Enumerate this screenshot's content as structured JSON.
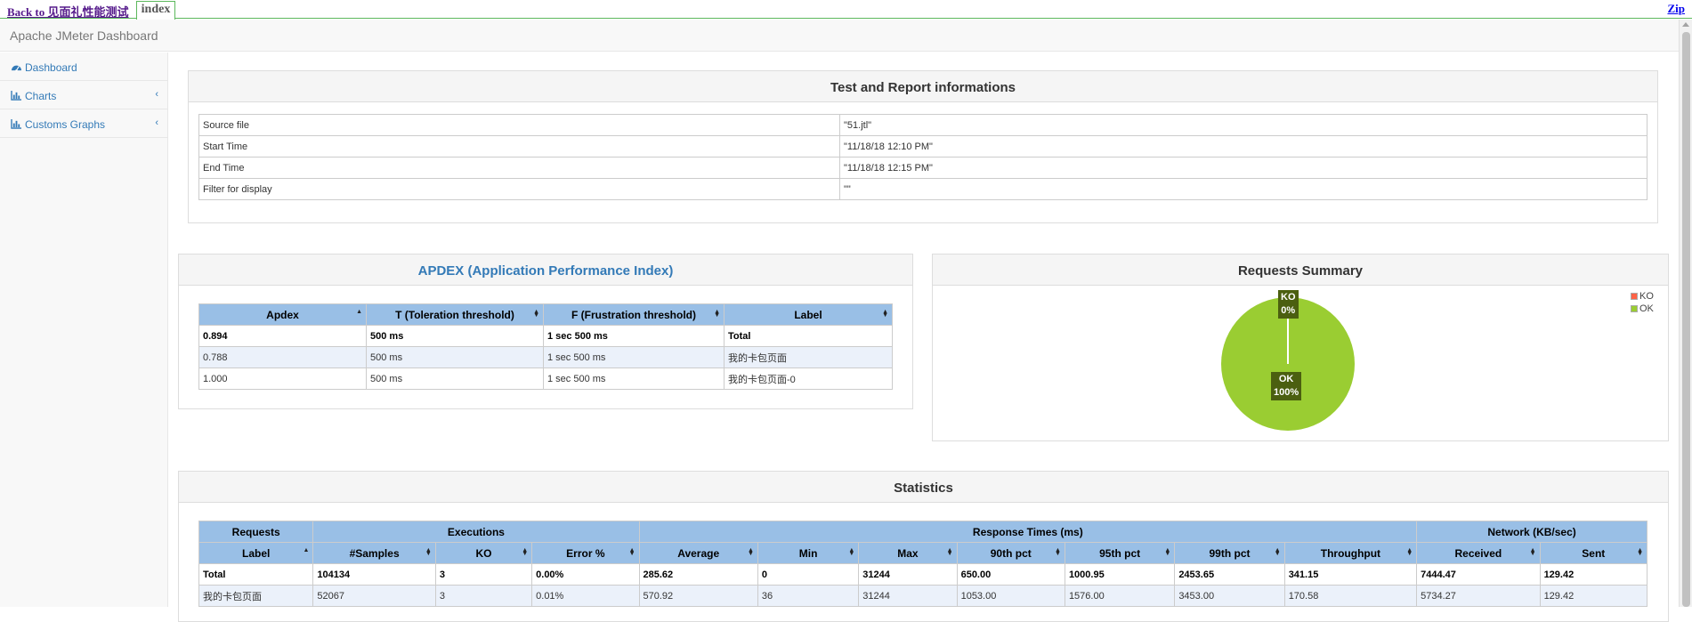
{
  "topbar": {
    "back_label": "Back to 见面礼性能测试",
    "tab_label": "index",
    "zip_label": "Zip"
  },
  "app": {
    "title": "Apache JMeter Dashboard"
  },
  "sidebar": {
    "items": [
      {
        "label": "Dashboard",
        "icon": "dashboard-icon"
      },
      {
        "label": "Charts",
        "icon": "bar-chart-icon"
      },
      {
        "label": "Customs Graphs",
        "icon": "bar-chart-icon"
      }
    ]
  },
  "info": {
    "title": "Test and Report informations",
    "rows": [
      {
        "key": "Source file",
        "value": "\"51.jtl\""
      },
      {
        "key": "Start Time",
        "value": "\"11/18/18 12:10 PM\""
      },
      {
        "key": "End Time",
        "value": "\"11/18/18 12:15 PM\""
      },
      {
        "key": "Filter for display",
        "value": "\"\""
      }
    ]
  },
  "apdex": {
    "title": "APDEX (Application Performance Index)",
    "headers": [
      "Apdex",
      "T (Toleration threshold)",
      "F (Frustration threshold)",
      "Label"
    ],
    "rows": [
      [
        "0.894",
        "500 ms",
        "1 sec 500 ms",
        "Total"
      ],
      [
        "0.788",
        "500 ms",
        "1 sec 500 ms",
        "我的卡包页面"
      ],
      [
        "1.000",
        "500 ms",
        "1 sec 500 ms",
        "我的卡包页面-0"
      ]
    ]
  },
  "summary": {
    "title": "Requests Summary",
    "legend": [
      {
        "label": "KO",
        "color": "#ff6347"
      },
      {
        "label": "OK",
        "color": "#9acd32"
      }
    ],
    "ko_label": "KO",
    "ko_pct": "0%",
    "ok_label": "OK",
    "ok_pct": "100%",
    "chart_data": {
      "type": "pie",
      "categories": [
        "KO",
        "OK"
      ],
      "values": [
        0,
        100
      ]
    }
  },
  "stats": {
    "title": "Statistics",
    "groups": [
      "Requests",
      "Executions",
      "Response Times (ms)",
      "Network (KB/sec)"
    ],
    "headers": [
      "Label",
      "#Samples",
      "KO",
      "Error %",
      "Average",
      "Min",
      "Max",
      "90th pct",
      "95th pct",
      "99th pct",
      "Throughput",
      "Received",
      "Sent"
    ],
    "rows": [
      [
        "Total",
        "104134",
        "3",
        "0.00%",
        "285.62",
        "0",
        "31244",
        "650.00",
        "1000.95",
        "2453.65",
        "341.15",
        "7444.47",
        "129.42"
      ],
      [
        "我的卡包页面",
        "52067",
        "3",
        "0.01%",
        "570.92",
        "36",
        "31244",
        "1053.00",
        "1576.00",
        "3453.00",
        "170.58",
        "5734.27",
        "129.42"
      ]
    ]
  },
  "colors": {
    "accent_green": "#5cb85c",
    "link_blue": "#337ab7",
    "header_blue": "#99bfe6",
    "pie_ok": "#9acd32",
    "pie_ko": "#ff6347"
  }
}
